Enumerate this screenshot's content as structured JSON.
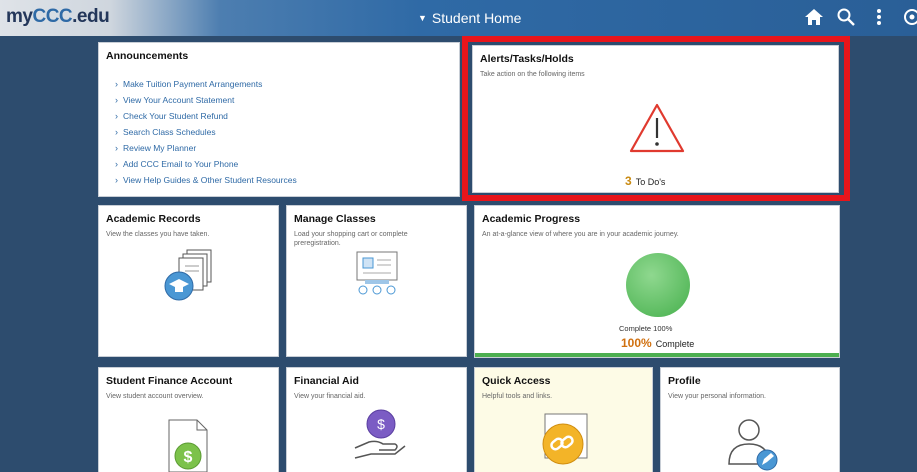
{
  "header": {
    "logo_prefix": "my",
    "logo_accent": "CCC",
    "logo_suffix": ".edu",
    "page_title": "Student Home",
    "bg_colors": [
      "#dfe3e8",
      "#2f6aa6"
    ],
    "icons": [
      "home-icon",
      "search-icon",
      "more-vert-icon",
      "navbar-icon"
    ]
  },
  "tiles": {
    "announcements": {
      "title": "Announcements",
      "links": [
        "Make Tuition Payment Arrangements",
        "View Your Account Statement",
        "Check Your Student Refund",
        "Search Class Schedules",
        "Review My Planner",
        "Add CCC Email to Your Phone",
        "View Help Guides & Other Student Resources"
      ]
    },
    "alerts": {
      "title": "Alerts/Tasks/Holds",
      "desc": "Take action on the following items",
      "count": "3",
      "count_label": "To Do's",
      "highlight_color": "#e8151b",
      "icon": "warning-triangle-icon"
    },
    "academic_records": {
      "title": "Academic Records",
      "desc": "View the classes you have taken.",
      "icon": "transcript-icon"
    },
    "manage_classes": {
      "title": "Manage Classes",
      "desc": "Load your shopping cart or complete preregistration.",
      "icon": "class-schedule-icon"
    },
    "academic_progress": {
      "title": "Academic Progress",
      "desc": "An at-a-glance view of where you are in your academic journey.",
      "chart_label": "Complete 100%",
      "percent": "100%",
      "percent_label": "Complete",
      "progress": 1.0,
      "accent_color": "#4caf50"
    },
    "student_finance": {
      "title": "Student Finance Account",
      "desc": "View student account overview.",
      "icon": "dollar-document-icon"
    },
    "financial_aid": {
      "title": "Financial Aid",
      "desc": "View your financial aid.",
      "icon": "coin-hand-icon"
    },
    "quick_access": {
      "title": "Quick Access",
      "desc": "Helpful tools and links.",
      "icon": "link-icon",
      "bg_color": "#fdfbe6"
    },
    "profile": {
      "title": "Profile",
      "desc": "View your personal information.",
      "icon": "profile-edit-icon"
    }
  }
}
